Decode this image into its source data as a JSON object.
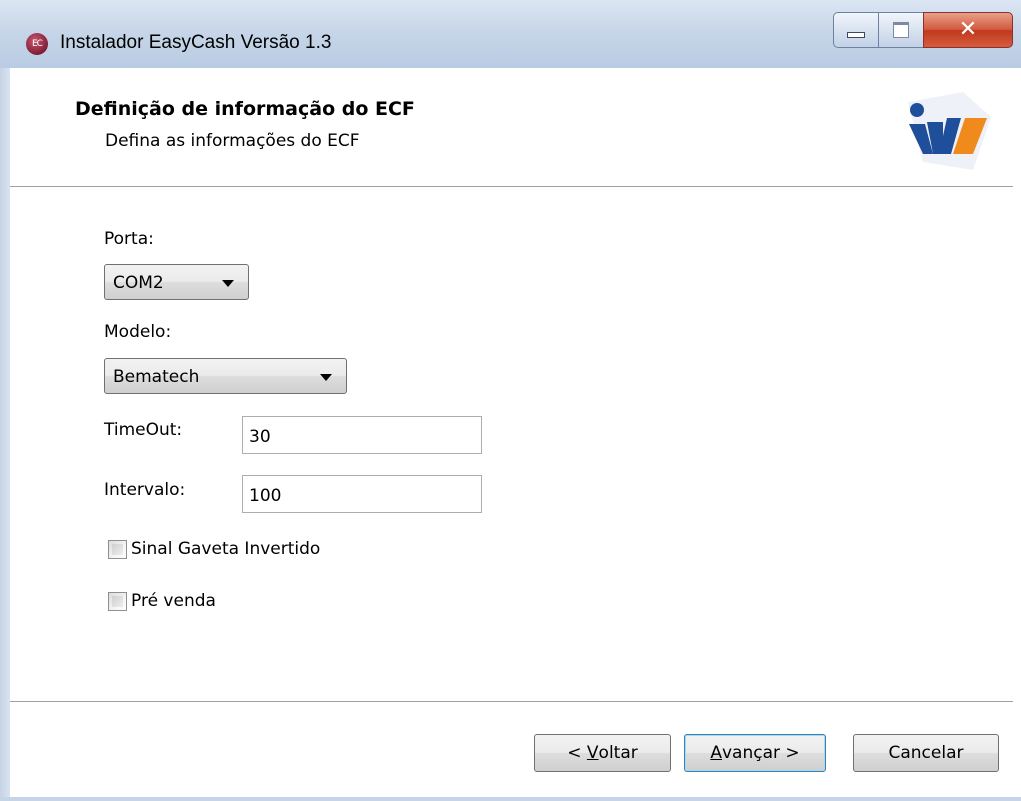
{
  "window": {
    "icon_text": "EC",
    "title": "Instalador EasyCash Versão 1.3",
    "minimize": "minimize",
    "maximize": "maximize",
    "close": "close"
  },
  "header": {
    "title": "Definição de informação do ECF",
    "subtitle": "Defina as informações do ECF",
    "logo_icon": "company-logo-icon"
  },
  "form": {
    "porta_label": "Porta:",
    "porta_value": "COM2",
    "modelo_label": "Modelo:",
    "modelo_value": "Bematech",
    "timeout_label": "TimeOut:",
    "timeout_value": "30",
    "intervalo_label": "Intervalo:",
    "intervalo_value": "100",
    "sinal_gaveta_label": "Sinal Gaveta Invertido",
    "sinal_gaveta_checked": false,
    "pre_venda_label": "Pré venda",
    "pre_venda_checked": false
  },
  "footer": {
    "back_prefix": "< ",
    "back_mnemonic": "V",
    "back_rest": "oltar",
    "next_mnemonic": "A",
    "next_rest": "vançar >",
    "cancel_label": "Cancelar"
  },
  "colors": {
    "title_gradient_top": "#dbe6f3",
    "close_red": "#c1391f",
    "logo_blue": "#1f4e9a",
    "logo_orange": "#f08a1c"
  }
}
